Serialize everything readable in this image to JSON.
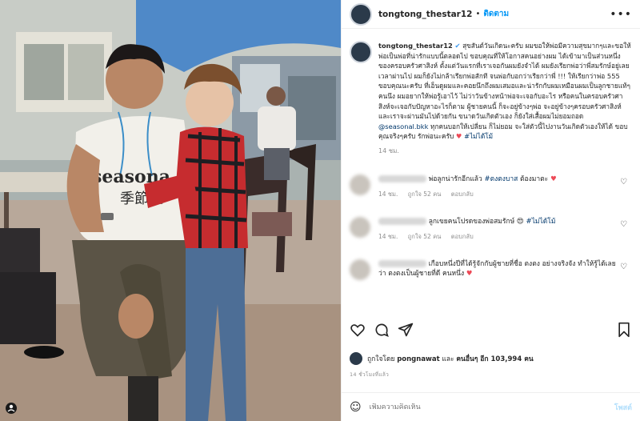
{
  "header": {
    "username": "tongtong_thestar12",
    "follow_label": "ติดตาม",
    "more_icon": "more-horizontal-icon"
  },
  "caption": {
    "username": "tongtong_thestar12",
    "text": "สุขสันต์วันเกิดนะครับ ผมขอให้พ่อมีความสุขมากๆและขอให้พ่อเป็นพ่อที่น่ารักแบบนี้ตลอดไป ขอบคุณที่ให้โอกาสคนอย่างผม ได้เข้ามาเป็นส่วนหนึ่งของครอบครัวศาสิงห์ ตั้งแต่วันแรกที่เราเจอกันผมยังจำได้ ผมยังเรียกพ่อว่าพี่สมรักษ์อยู่เลย เวลาผ่านไป ผมก็ยังไม่กล้าเรียกพ่อสักที จนพ่อกับอกว่าเรียกว่าพี่ !!! ให้เรียกว่าพ่อ 555 ขอบคุณนะครับ ที่เอ็นดูผมและคอยนึกถึงผมเสมอและน่ารักกับผมเหมือนผมเป็นลูกชายแท้ๆคนนึง ผมอยากให้พ่อรู้เอาไว้ ไม่ว่าวันข้างหน้าพ่อจะเจอกับอะไร หรือคนในครอบครัวศาสิงห์จะเจอกับปัญหาอะไรก็ตาม ผู้ชายคนนี้ ก็จะอยู่ข้างๆพ่อ จะอยู่ข้างๆครอบครัวศาสิงห์ และเราจะผ่านมันไปด้วยกัน ขนาดวันเกิดตัวเอง ก็ยังใส่เสื้อผมไม่ยอมถอด",
    "link": "@seasonal.bkk",
    "text_after": " ทุกคนบอกให้เปลี่ยน ก็ไม่ยอม จะใส่ตัวนี้ไปงานวันเกิดตัวเองให้ได้ ขอบคุณจริงๆครับ รักพ่อนะครับ",
    "heart": "♥",
    "hashtag": "#ไม่ได้โม้",
    "time": "14 ชม."
  },
  "comments": [
    {
      "text": "พ่อลูกน่ารักอีกแล้ว ",
      "hashtag": "#ตงตงบาส",
      "text_after": " ต้องมาตะ ",
      "emoji": "♥",
      "time": "14 ชม.",
      "likes": "ถูกใจ 52 คน",
      "reply": "ตอบกลับ"
    },
    {
      "text": "ลูกเขยคนโปรดของพ่อสมรักษ์ ",
      "emoji": "😍",
      "hashtag": "#ไม่ได้โม้",
      "time": "14 ชม.",
      "likes": "ถูกใจ 52 คน",
      "reply": "ตอบกลับ"
    },
    {
      "text": "เกือบหนึ่งปีที่ได้รู้จักกับผู้ชายที่ชื่อ ตงตง อย่างจริงจัง ทำให้รู้ได้เลยว่า ตงตงเป็นผู้ชายที่ดี คนหนึ่ง ",
      "emoji": "♥"
    }
  ],
  "actions": {
    "like_icon": "heart-icon",
    "comment_icon": "comment-icon",
    "share_icon": "share-icon",
    "save_icon": "bookmark-icon"
  },
  "likes": {
    "prefix": "ถูกใจโดย",
    "user": "pongnawat",
    "middle": "และ",
    "others": "คนอื่นๆ อีก 103,994 คน"
  },
  "date": "14 ชั่วโมงที่แล้ว",
  "add_comment": {
    "placeholder": "เพิ่มความคิดเห็น",
    "post_label": "โพสต์"
  },
  "photo": {
    "shirt_text_1": "seasona",
    "shirt_text_2": "季節性"
  }
}
